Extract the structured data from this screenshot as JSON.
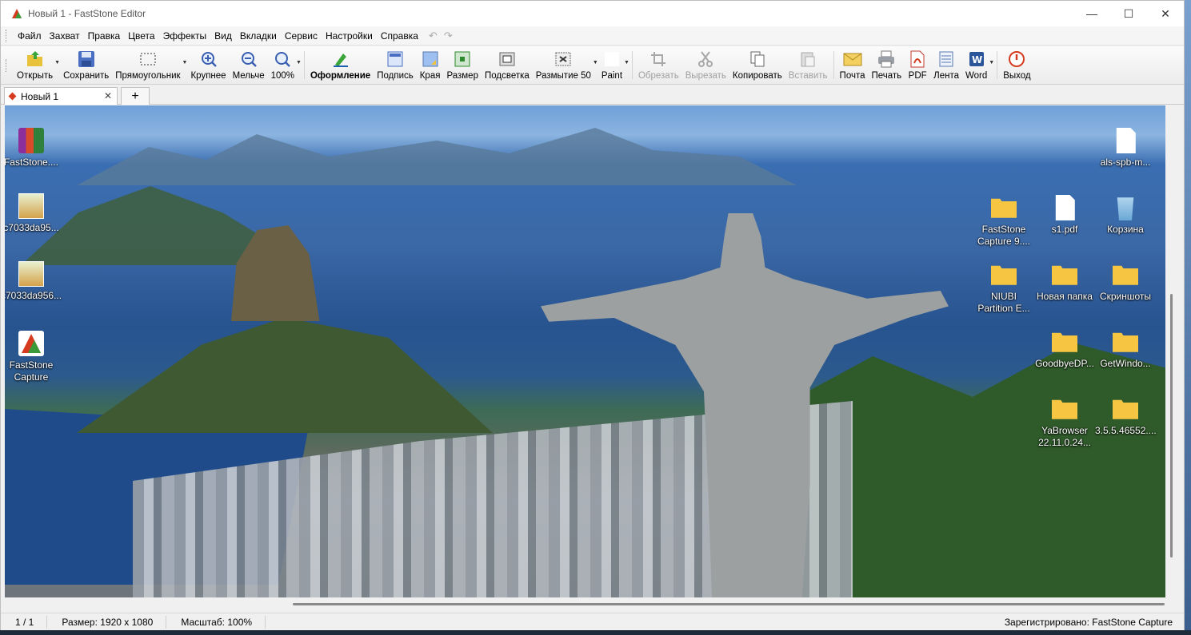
{
  "window": {
    "title": "Новый 1 - FastStone Editor"
  },
  "menu": [
    "Файл",
    "Захват",
    "Правка",
    "Цвета",
    "Эффекты",
    "Вид",
    "Вкладки",
    "Сервис",
    "Настройки",
    "Справка"
  ],
  "toolbar": {
    "open": "Открыть",
    "save": "Сохранить",
    "rect": "Прямоугольник",
    "zoom_in": "Крупнее",
    "zoom_out": "Мельче",
    "zoom": "100%",
    "design": "Оформление",
    "caption": "Подпись",
    "edges": "Края",
    "resize": "Размер",
    "highlight": "Подсветка",
    "blur": "Размытие 50",
    "paint": "Paint",
    "crop": "Обрезать",
    "cut": "Вырезать",
    "copy": "Копировать",
    "paste": "Вставить",
    "mail": "Почта",
    "print": "Печать",
    "pdf": "PDF",
    "ribbon": "Лента",
    "word": "Word",
    "exit": "Выход"
  },
  "tab": {
    "name": "Новый 1",
    "close": "✕",
    "add": "+"
  },
  "desktop": {
    "left": [
      {
        "label": "FastStone...."
      },
      {
        "label": "c7033da95..."
      },
      {
        "label": "c7033da956..."
      },
      {
        "label": "FastStone Capture"
      }
    ],
    "right": [
      {
        "label": "als-spb-m..."
      },
      {
        "label": "FastStone Capture 9...."
      },
      {
        "label": "s1.pdf"
      },
      {
        "label": "Корзина"
      },
      {
        "label": "NIUBI Partition E..."
      },
      {
        "label": "Новая папка"
      },
      {
        "label": "Скриншоты"
      },
      {
        "label": "GoodbyeDP..."
      },
      {
        "label": "GetWindo..."
      },
      {
        "label": "YaBrowser 22.11.0.24..."
      },
      {
        "label": "3.5.5.46552...."
      }
    ]
  },
  "status": {
    "page": "1 / 1",
    "size": "Размер: 1920 x 1080",
    "scale": "Масштаб: 100%",
    "registered": "Зарегистрировано: FastStone Capture"
  },
  "colors": {
    "accent_red": "#d43b1f",
    "folder": "#f6c542"
  }
}
